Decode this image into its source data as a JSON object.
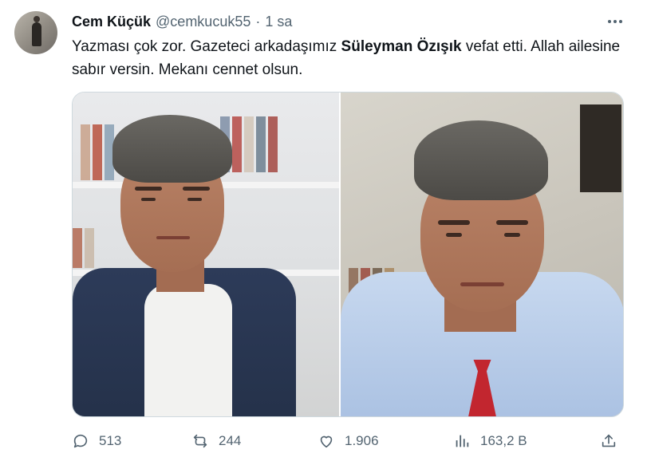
{
  "tweet": {
    "author_name": "Cem Küçük",
    "author_handle": "@cemkucuk55",
    "separator": "·",
    "time": "1 sa",
    "text_before": "Yazması çok zor. Gazeteci arkadaşımız ",
    "text_bold": "Süleyman Özışık",
    "text_after": " vefat etti. Allah ailesine sabır versin. Mekanı cennet olsun."
  },
  "actions": {
    "replies": "513",
    "retweets": "244",
    "likes": "1.906",
    "views": "163,2 B"
  },
  "icons": {
    "more": "more-icon",
    "reply": "reply-icon",
    "retweet": "retweet-icon",
    "like": "heart-icon",
    "views": "views-icon",
    "share": "share-icon"
  },
  "colors": {
    "text_primary": "#0f1419",
    "text_secondary": "#536471",
    "border": "#cfd9de"
  }
}
